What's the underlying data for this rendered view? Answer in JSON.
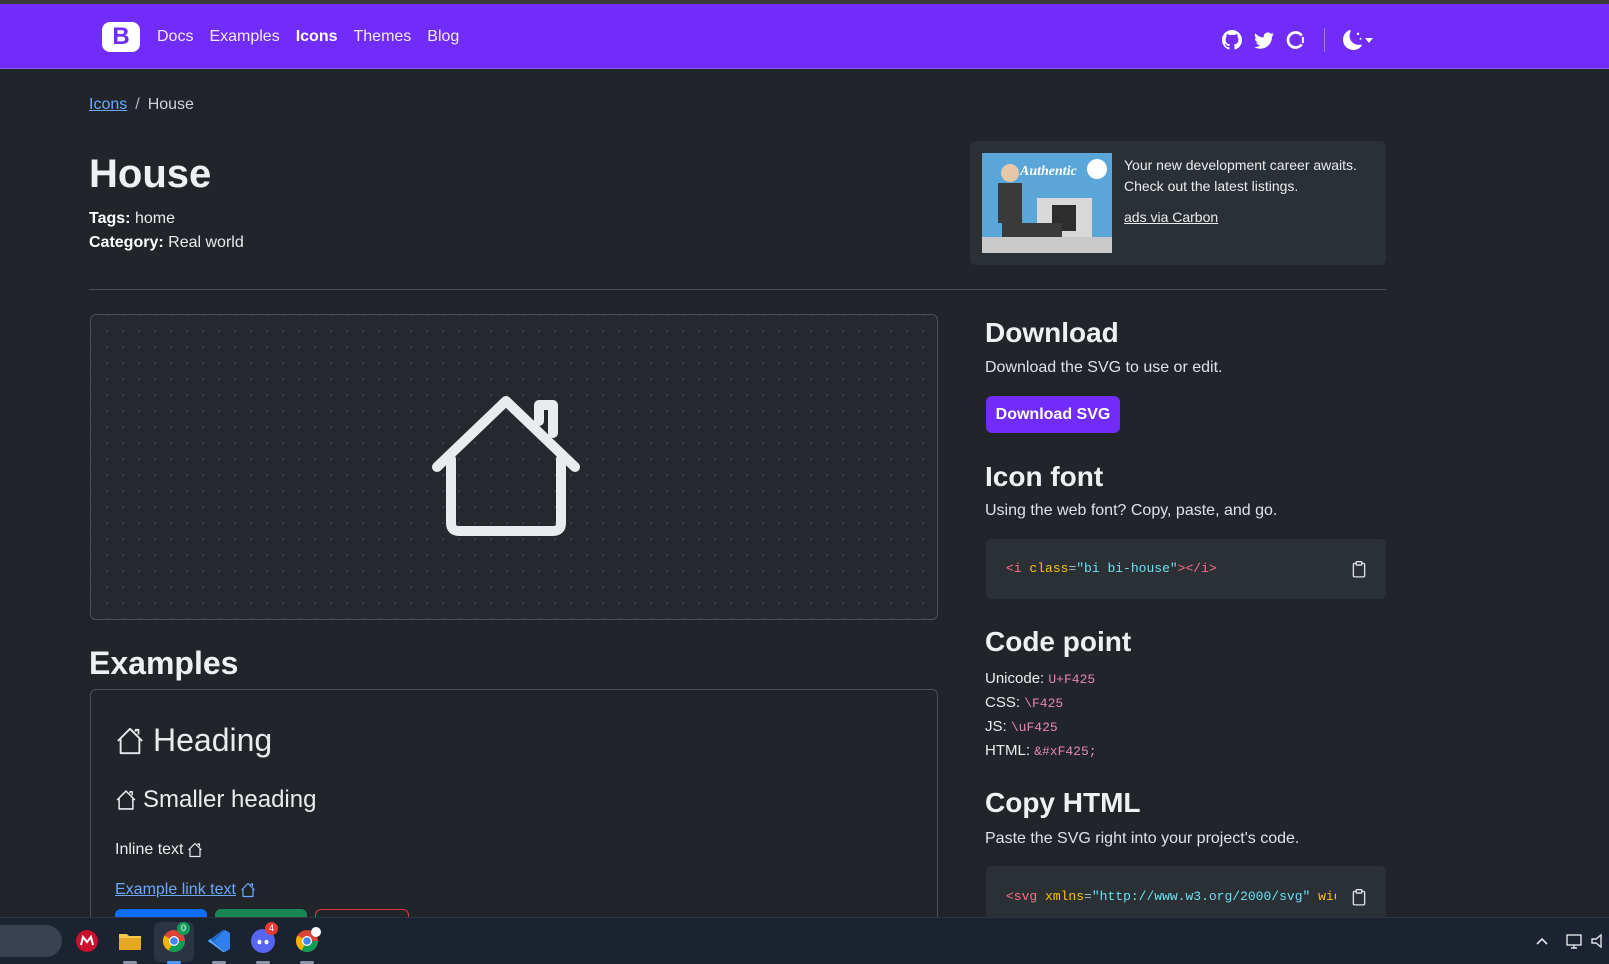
{
  "navbar": {
    "brand_letter": "B",
    "links": [
      {
        "label": "Docs",
        "active": false
      },
      {
        "label": "Examples",
        "active": false
      },
      {
        "label": "Icons",
        "active": true
      },
      {
        "label": "Themes",
        "active": false
      },
      {
        "label": "Blog",
        "active": false
      }
    ],
    "icons": [
      "github-icon",
      "twitter-icon",
      "opencollective-icon",
      "theme-toggle-moon-icon"
    ],
    "accent_color": "#712cf9"
  },
  "breadcrumb": {
    "parent": "Icons",
    "separator": "/",
    "current": "House"
  },
  "header": {
    "title": "House",
    "tags_label": "Tags:",
    "tags_value": "home",
    "category_label": "Category:",
    "category_value": "Real world"
  },
  "ad": {
    "image_logo_text": "Authentic",
    "text": "Your new development career awaits. Check out the latest listings.",
    "link": "ads via Carbon"
  },
  "preview": {
    "icon": "house-icon"
  },
  "examples": {
    "title": "Examples",
    "heading": "Heading",
    "smaller_heading": "Smaller heading",
    "inline_text": "Inline text",
    "link_text": "Example link text",
    "button_colors": [
      "#0d6efd",
      "#198754",
      "#dc3545"
    ]
  },
  "download": {
    "title": "Download",
    "description": "Download the SVG to use or edit.",
    "button": "Download SVG"
  },
  "icon_font": {
    "title": "Icon font",
    "description": "Using the web font? Copy, paste, and go.",
    "code": {
      "open": "<i",
      "attr": "class",
      "value": "\"bi bi-house\"",
      "close": "></i>"
    }
  },
  "code_point": {
    "title": "Code point",
    "rows": [
      {
        "label": "Unicode:",
        "value": "U+F425"
      },
      {
        "label": "CSS:",
        "value": "\\F425"
      },
      {
        "label": "JS:",
        "value": "\\uF425"
      },
      {
        "label": "HTML:",
        "value": "&#xF425;"
      }
    ]
  },
  "copy_html": {
    "title": "Copy HTML",
    "description": "Paste the SVG right into your project's code.",
    "code": {
      "open": "<svg",
      "attr": "xmlns",
      "value": "\"http://www.w3.org/2000/svg\"",
      "tail": "wid"
    }
  },
  "taskbar": {
    "apps": [
      {
        "name": "mcafee-icon",
        "badge": ""
      },
      {
        "name": "file-explorer-icon",
        "badge": ""
      },
      {
        "name": "chrome-icon",
        "badge": "0"
      },
      {
        "name": "vscode-icon",
        "badge": ""
      },
      {
        "name": "discord-icon",
        "badge": "4"
      },
      {
        "name": "chrome-profile-icon",
        "badge": ""
      }
    ]
  }
}
